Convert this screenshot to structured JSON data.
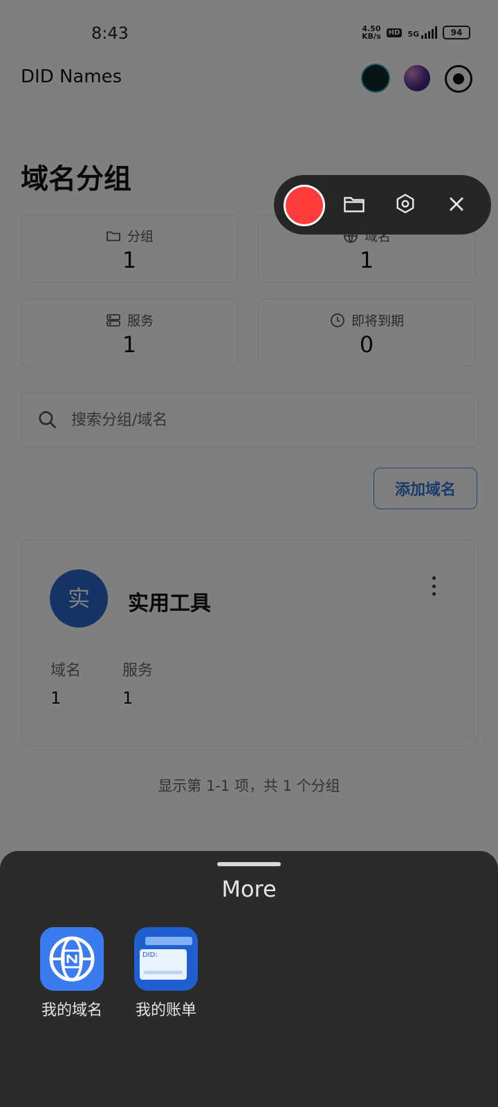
{
  "status_bar": {
    "time": "8:43",
    "net_speed_value": "4.50",
    "net_speed_unit": "KB/s",
    "hd": "HD",
    "network": "5G",
    "battery": "94"
  },
  "header": {
    "title": "DID Names"
  },
  "page": {
    "heading": "域名分组"
  },
  "stats": {
    "groups": {
      "label": "分组",
      "value": "1"
    },
    "domains": {
      "label": "域名",
      "value": "1"
    },
    "services": {
      "label": "服务",
      "value": "1"
    },
    "expiring": {
      "label": "即将到期",
      "value": "0"
    }
  },
  "search": {
    "placeholder": "搜索分组/域名"
  },
  "actions": {
    "add_domain": "添加域名"
  },
  "group_card": {
    "avatar_char": "实",
    "name": "实用工具",
    "domains_label": "域名",
    "domains_value": "1",
    "services_label": "服务",
    "services_value": "1"
  },
  "pagination": {
    "summary": "显示第 1-1 项，共 1 个分组"
  },
  "sheet": {
    "title": "More",
    "items": [
      {
        "label": "我的域名",
        "icon": "globe-icon"
      },
      {
        "label": "我的账单",
        "icon": "bill-icon",
        "card_text": "DID:"
      }
    ]
  },
  "colors": {
    "accent": "#2f78d6",
    "record": "#ff3b3b",
    "sheet_bg": "#2b2b2b"
  }
}
